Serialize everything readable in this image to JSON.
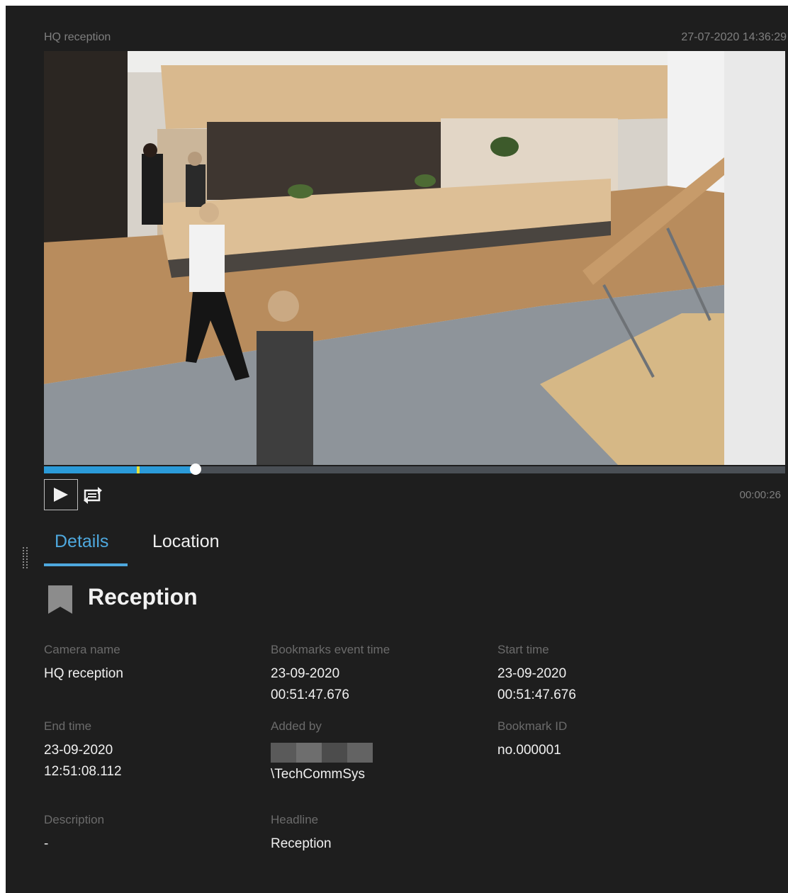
{
  "camera": {
    "title": "HQ reception",
    "timestamp": "27-07-2020 14:36:29"
  },
  "playback": {
    "progress": 0.205,
    "marker_position": 0.127,
    "duration": "00:00:26",
    "play_icon": "play-icon",
    "loop_icon": "loop-icon"
  },
  "tabs": [
    {
      "label": "Details",
      "active": true
    },
    {
      "label": "Location",
      "active": false
    }
  ],
  "bookmark": {
    "icon": "bookmark-icon",
    "title": "Reception"
  },
  "fields": {
    "camera_name": {
      "label": "Camera name",
      "value": "HQ reception"
    },
    "event_time": {
      "label": "Bookmarks event time",
      "value": "23-09-2020\n00:51:47.676"
    },
    "start_time": {
      "label": "Start time",
      "value": "23-09-2020\n00:51:47.676"
    },
    "end_time": {
      "label": "End time",
      "value": "23-09-2020\n12:51:08.112"
    },
    "added_by": {
      "label": "Added by",
      "value": "\\TechCommSys"
    },
    "bookmark_id": {
      "label": "Bookmark ID",
      "value": "no.000001"
    },
    "description": {
      "label": "Description",
      "value": "-"
    },
    "headline": {
      "label": "Headline",
      "value": "Reception"
    }
  },
  "colors": {
    "panel_bg": "#1e1e1e",
    "accent": "#4ea8de",
    "timeline_fill": "#2b9bd9",
    "marker": "#e6e23a",
    "label_gray": "#6b6b6b"
  }
}
